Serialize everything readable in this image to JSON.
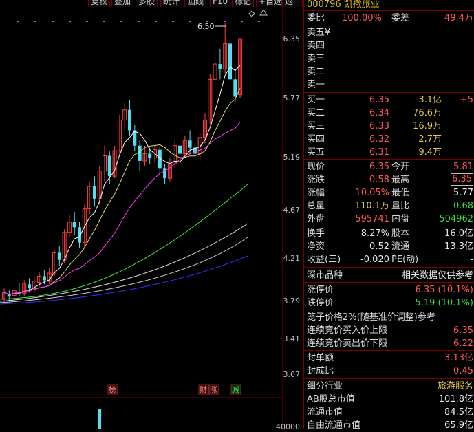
{
  "toolbar": {
    "buttons": [
      "复权",
      "叠加",
      "多股",
      "统计",
      "画线",
      "F10",
      "标记",
      "+自选",
      "返回"
    ]
  },
  "chart": {
    "peak_label": "6.50",
    "price_ticks": [
      "6.35",
      "5.77",
      "5.19",
      "4.67",
      "4.21",
      "3.79",
      "3.41",
      "3.07"
    ],
    "volume_tick": "40000",
    "event_tags": [
      "榜",
      "财",
      "涨",
      "减"
    ],
    "colors": {
      "up": "#ff4040",
      "down": "#50e0f0",
      "ma5": "#ffffff",
      "ma10": "#e0e070",
      "ma20": "#ff40ff",
      "ma60": "#40e040",
      "ma120": "#e0e0e0",
      "ma250": "#3030ff"
    }
  },
  "panel": {
    "title": "000796 凯撒旅业",
    "weibi": {
      "label": "委比",
      "value": "100.00%",
      "diff_label": "委差",
      "diff": "49.4万"
    },
    "asks": [
      {
        "label": "卖五",
        "price": "¥",
        "vol": ""
      },
      {
        "label": "卖四",
        "price": "",
        "vol": ""
      },
      {
        "label": "卖三",
        "price": "",
        "vol": ""
      },
      {
        "label": "卖二",
        "price": "",
        "vol": ""
      },
      {
        "label": "卖一",
        "price": "",
        "vol": ""
      }
    ],
    "bids": [
      {
        "label": "买一",
        "price": "6.35",
        "vol": "3.1亿",
        "extra": "+5"
      },
      {
        "label": "买二",
        "price": "6.34",
        "vol": "76.6万",
        "extra": ""
      },
      {
        "label": "买三",
        "price": "6.33",
        "vol": "16.9万",
        "extra": ""
      },
      {
        "label": "买四",
        "price": "6.32",
        "vol": "2.7万",
        "extra": ""
      },
      {
        "label": "买五",
        "price": "6.31",
        "vol": "9.4万",
        "extra": ""
      }
    ],
    "quote": [
      {
        "l1": "现价",
        "v1": "6.35",
        "l2": "今开",
        "v2": "5.81",
        "c1": "red",
        "c2": "red"
      },
      {
        "l1": "涨跌",
        "v1": "0.58",
        "l2": "最高",
        "v2": "6.35",
        "c1": "red",
        "c2": "red"
      },
      {
        "l1": "涨幅",
        "v1": "10.05%",
        "l2": "最低",
        "v2": "5.77",
        "c1": "red",
        "c2": "white"
      },
      {
        "l1": "总量",
        "v1": "110.1万",
        "l2": "量比",
        "v2": "0.68",
        "c1": "yellow",
        "c2": "green"
      },
      {
        "l1": "外盘",
        "v1": "595741",
        "l2": "内盘",
        "v2": "504962",
        "c1": "red",
        "c2": "green"
      }
    ],
    "fundamentals": [
      {
        "l1": "换手",
        "v1": "8.27%",
        "l2": "股本",
        "v2": "16.0亿"
      },
      {
        "l1": "净资",
        "v1": "0.52",
        "l2": "流通",
        "v2": "13.3亿"
      },
      {
        "l1": "收益(三)",
        "v1": "-0.020",
        "l2": "PE(动)",
        "v2": "-"
      }
    ],
    "market": {
      "label": "深市品种",
      "note": "相关数据仅供参考"
    },
    "limits": [
      {
        "label": "涨停价",
        "value": "6.35 (10.1%)",
        "color": "red"
      },
      {
        "label": "跌停价",
        "value": "5.19 (10.1%)",
        "color": "green"
      }
    ],
    "cage": {
      "title": "笼子价格2%(随基准价调整)参考",
      "rows": [
        {
          "label": "连续竞价买入价上限",
          "value": "6.35"
        },
        {
          "label": "连续竞价卖出价下限",
          "value": "6.22"
        }
      ]
    },
    "seal": [
      {
        "label": "封单额",
        "value": "3.13亿"
      },
      {
        "label": "封成比",
        "value": "0.45"
      }
    ],
    "industry": {
      "label": "细分行业",
      "value": "旅游服务"
    },
    "caps": [
      {
        "label": "AB股总市值",
        "value": "101.8亿"
      },
      {
        "label": "流通市值",
        "value": "84.5亿"
      },
      {
        "label": "自由流通市值",
        "value": "65.9亿"
      }
    ]
  }
}
